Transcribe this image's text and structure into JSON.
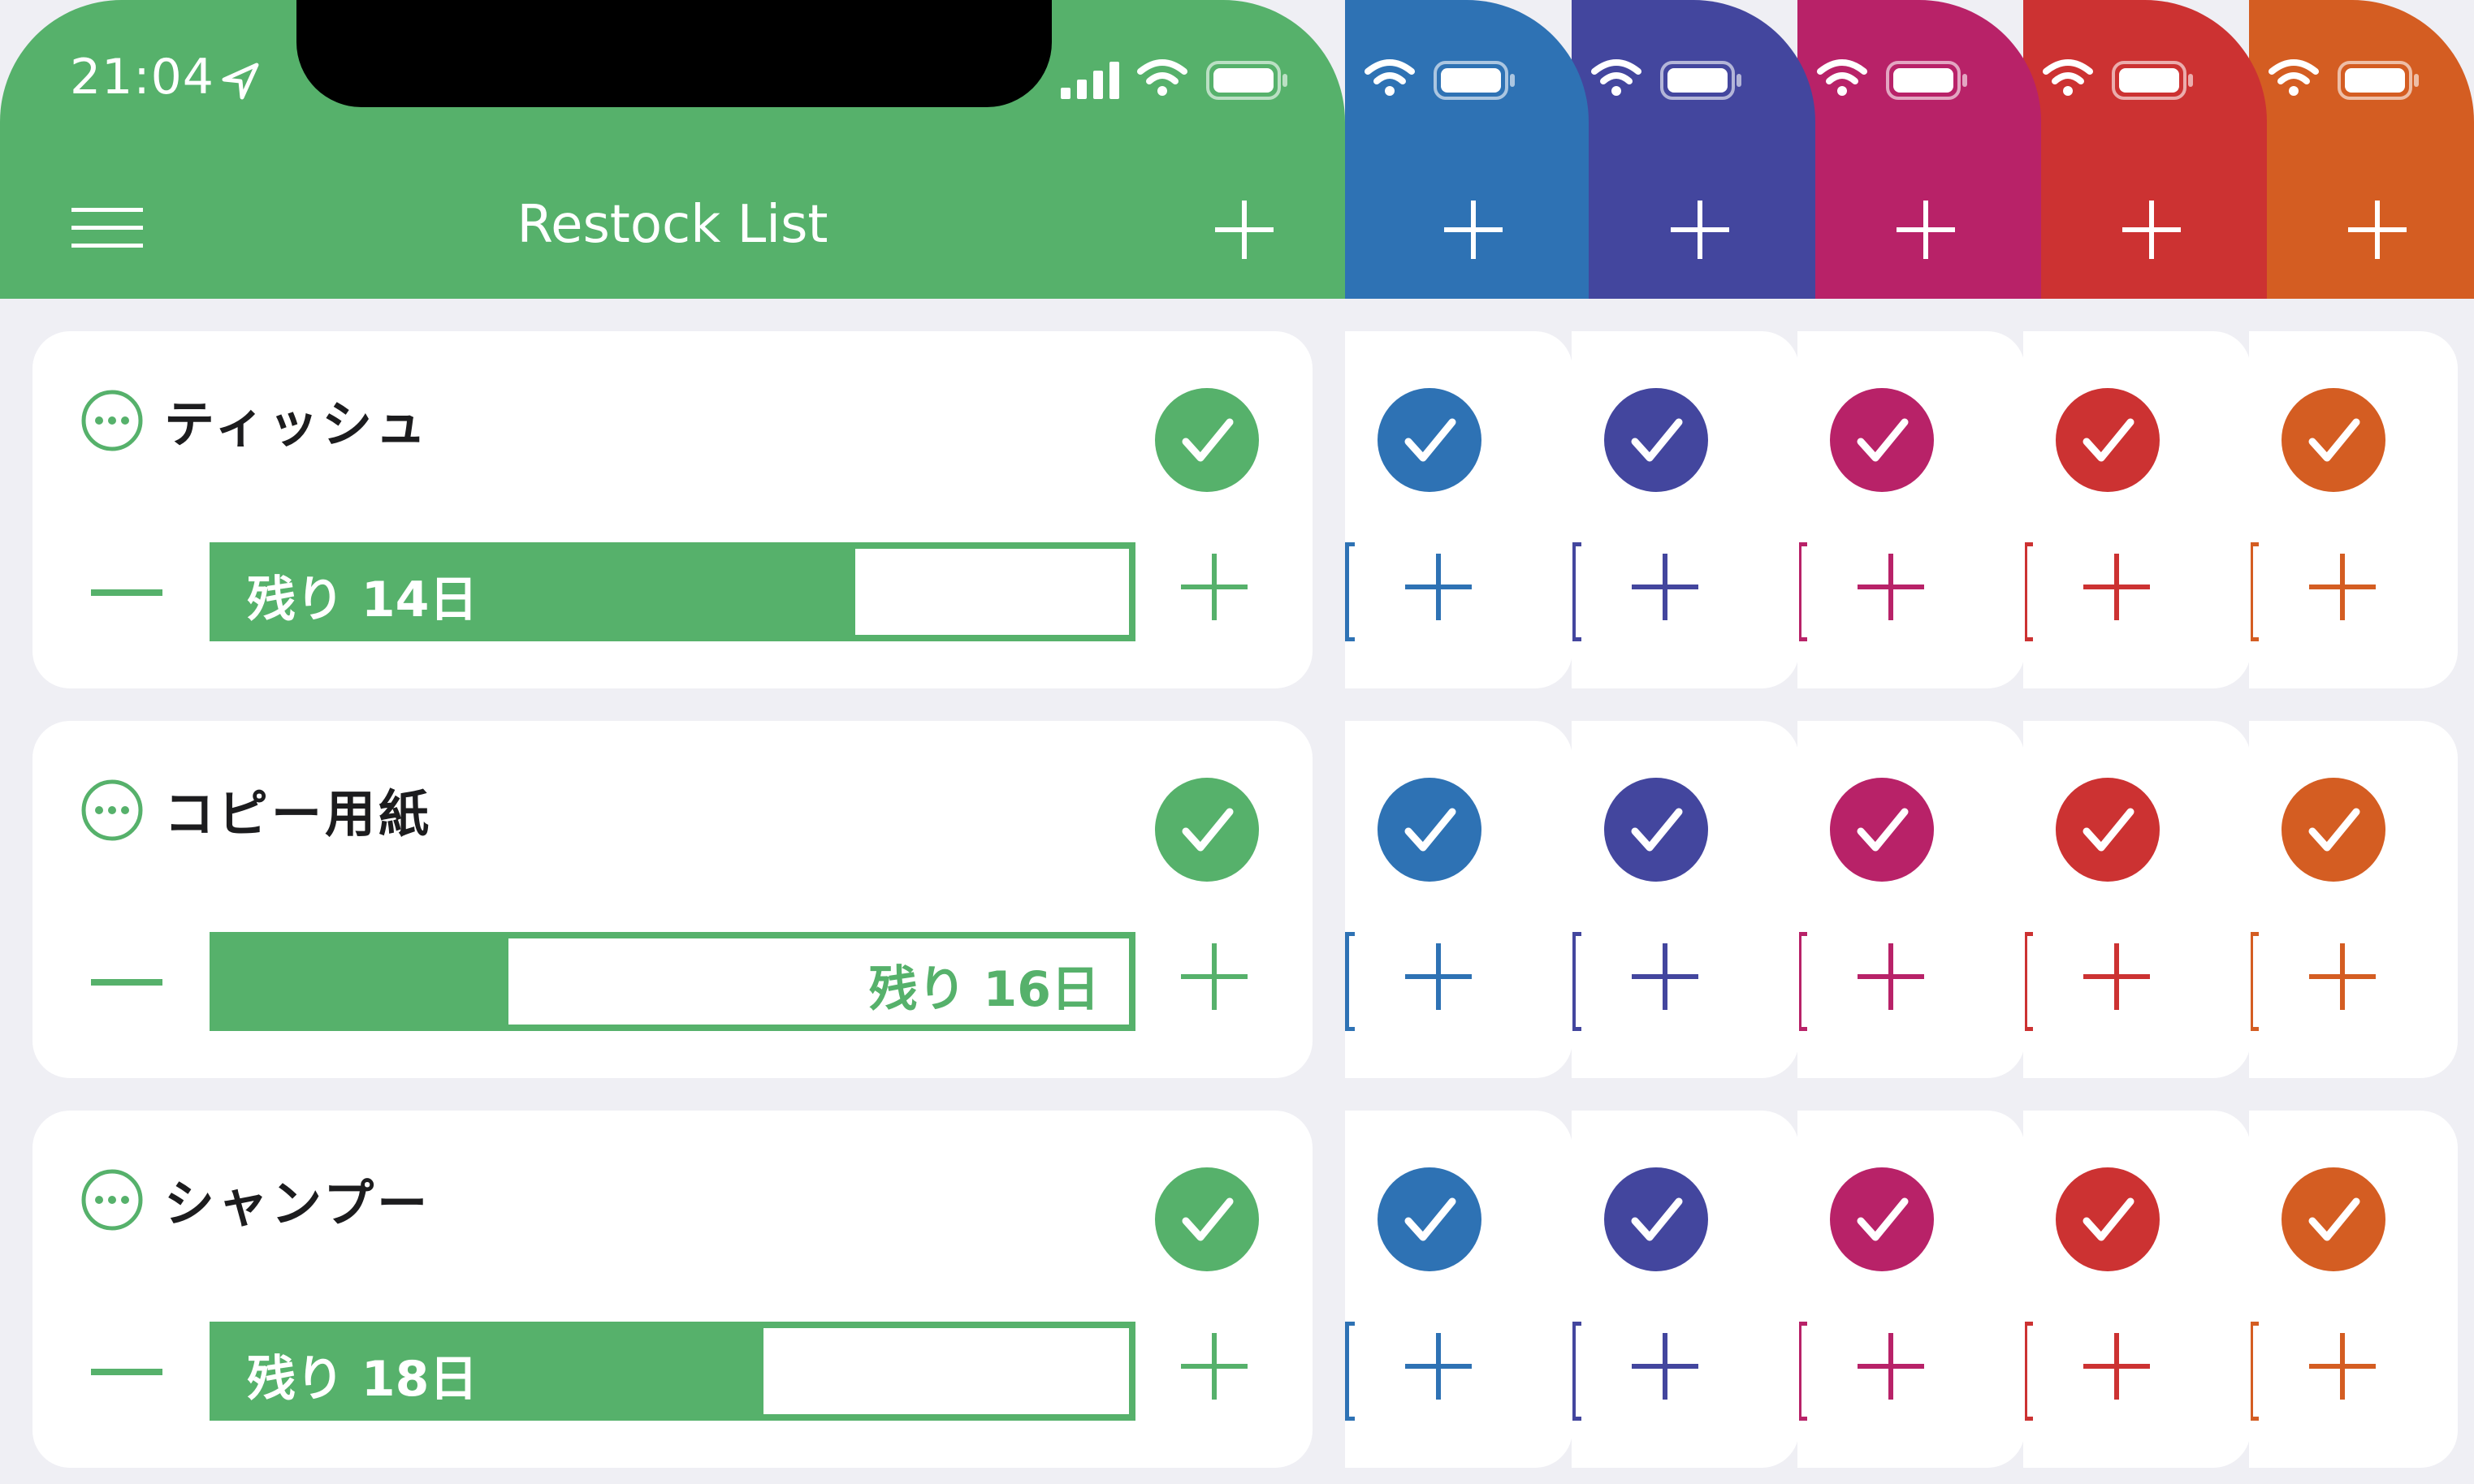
{
  "status_bar": {
    "time": "21:04"
  },
  "nav": {
    "title": "Restock List"
  },
  "items": [
    {
      "name": "ティッシュ",
      "remaining_label": "残り 14日",
      "fill_fraction": 0.7,
      "label_position": "inside-fill"
    },
    {
      "name": "コピー用紙",
      "remaining_label": "残り 16日",
      "fill_fraction": 0.32,
      "label_position": "in-empty"
    },
    {
      "name": "シャンプー",
      "remaining_label": "残り 18日",
      "fill_fraction": 0.6,
      "label_position": "inside-fill"
    }
  ],
  "themes": [
    {
      "name": "green",
      "color": "#56b16b"
    },
    {
      "name": "blue",
      "color": "#2e72b4"
    },
    {
      "name": "indigo",
      "color": "#43469e"
    },
    {
      "name": "magenta",
      "color": "#b82268"
    },
    {
      "name": "red",
      "color": "#cc3232"
    },
    {
      "name": "orange",
      "color": "#d45d22"
    }
  ],
  "icons": [
    "location-arrow-icon",
    "signal-icon",
    "wifi-icon",
    "battery-icon",
    "menu-icon",
    "add-icon",
    "more-icon",
    "check-icon",
    "minus-icon",
    "plus-icon"
  ]
}
